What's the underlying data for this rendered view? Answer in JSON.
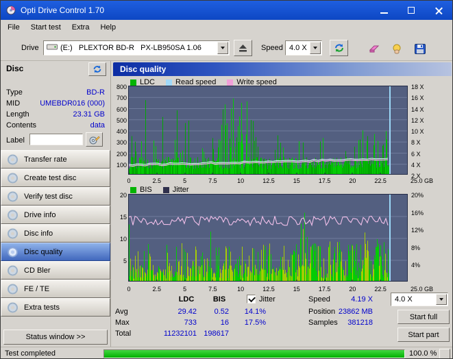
{
  "titlebar": {
    "title": "Opti Drive Control 1.70"
  },
  "menubar": {
    "items": [
      "File",
      "Start test",
      "Extra",
      "Help"
    ]
  },
  "toolbar": {
    "drive_label": "Drive",
    "drive_value": "(E:)   PLEXTOR BD-R   PX-LB950SA 1.06",
    "speed_label": "Speed",
    "speed_value": "4.0 X"
  },
  "sidebar": {
    "header": "Disc",
    "fields": [
      {
        "label": "Type",
        "value": "BD-R"
      },
      {
        "label": "MID",
        "value": "UMEBDR016 (000)"
      },
      {
        "label": "Length",
        "value": "23.31 GB"
      },
      {
        "label": "Contents",
        "value": "data"
      }
    ],
    "label_field": {
      "label": "Label",
      "value": ""
    },
    "buttons": [
      "Transfer rate",
      "Create test disc",
      "Verify test disc",
      "Drive info",
      "Disc info",
      "Disc quality",
      "CD Bler",
      "FE / TE",
      "Extra tests"
    ],
    "selected_index": 5,
    "status_window_label": "Status window >>"
  },
  "panel": {
    "title": "Disc quality"
  },
  "chart_data": [
    {
      "type": "bar",
      "name": "ldc-speed-chart",
      "legend": [
        {
          "label": "LDC",
          "color": "#04b404",
          "style": "bars"
        },
        {
          "label": "Read speed",
          "color": "#a0d8f8",
          "style": "line"
        },
        {
          "label": "Write speed",
          "color": "#f0a0d8",
          "style": "line"
        }
      ],
      "ylim": [
        0,
        800
      ],
      "y_left_ticks": [
        "800",
        "700",
        "600",
        "500",
        "400",
        "300",
        "200",
        "100"
      ],
      "y_right_ticks": [
        "18 X",
        "16 X",
        "14 X",
        "12 X",
        "10 X",
        "8 X",
        "6 X",
        "4 X",
        "2 X"
      ],
      "x_ticks": [
        "0",
        "2.5",
        "5",
        "7.5",
        "10",
        "12.5",
        "15",
        "17.5",
        "20",
        "22.5"
      ],
      "x_end_label": "25.0 GB",
      "x_range_gb": [
        0,
        25
      ],
      "end_marker_gb": 23.3,
      "series_stats": {
        "ldc_avg": 29.42,
        "ldc_max": 733,
        "ldc_total": 11232101,
        "read_speed_avg_x": 4.19
      }
    },
    {
      "type": "bar",
      "name": "bis-jitter-chart",
      "legend": [
        {
          "label": "BIS",
          "color": "#04b404",
          "style": "bars"
        },
        {
          "label": "Jitter",
          "color": "#30304c",
          "style": "line"
        }
      ],
      "ylim": [
        0,
        20
      ],
      "y_left_ticks": [
        "20",
        "15",
        "10",
        "5"
      ],
      "y_right_ticks": [
        "20%",
        "16%",
        "12%",
        "8%",
        "4%"
      ],
      "x_ticks": [
        "0",
        "2.5",
        "5",
        "7.5",
        "10",
        "12.5",
        "15",
        "17.5",
        "20",
        "22.5"
      ],
      "x_end_label": "25.0 GB",
      "x_range_gb": [
        0,
        25
      ],
      "end_marker_gb": 23.3,
      "series_stats": {
        "bis_avg": 0.52,
        "bis_max": 16,
        "bis_total": 198617,
        "jitter_avg_pct": 14.1,
        "jitter_max_pct": 17.5
      }
    }
  ],
  "stats": {
    "columns": [
      "LDC",
      "BIS"
    ],
    "jitter_label": "Jitter",
    "jitter_checked": true,
    "rows": [
      {
        "label": "Avg",
        "ldc": "29.42",
        "bis": "0.52",
        "jitter": "14.1%"
      },
      {
        "label": "Max",
        "ldc": "733",
        "bis": "16",
        "jitter": "17.5%"
      },
      {
        "label": "Total",
        "ldc": "11232101",
        "bis": "198617",
        "jitter": ""
      }
    ],
    "info": [
      {
        "label": "Speed",
        "value": "4.19 X"
      },
      {
        "label": "Position",
        "value": "23862 MB"
      },
      {
        "label": "Samples",
        "value": "381218"
      }
    ],
    "speed_select_value": "4.0 X",
    "start_full_label": "Start full",
    "start_part_label": "Start part"
  },
  "statusbar": {
    "text": "Test completed",
    "percent_label": "100.0 %",
    "progress_pct": 100
  }
}
